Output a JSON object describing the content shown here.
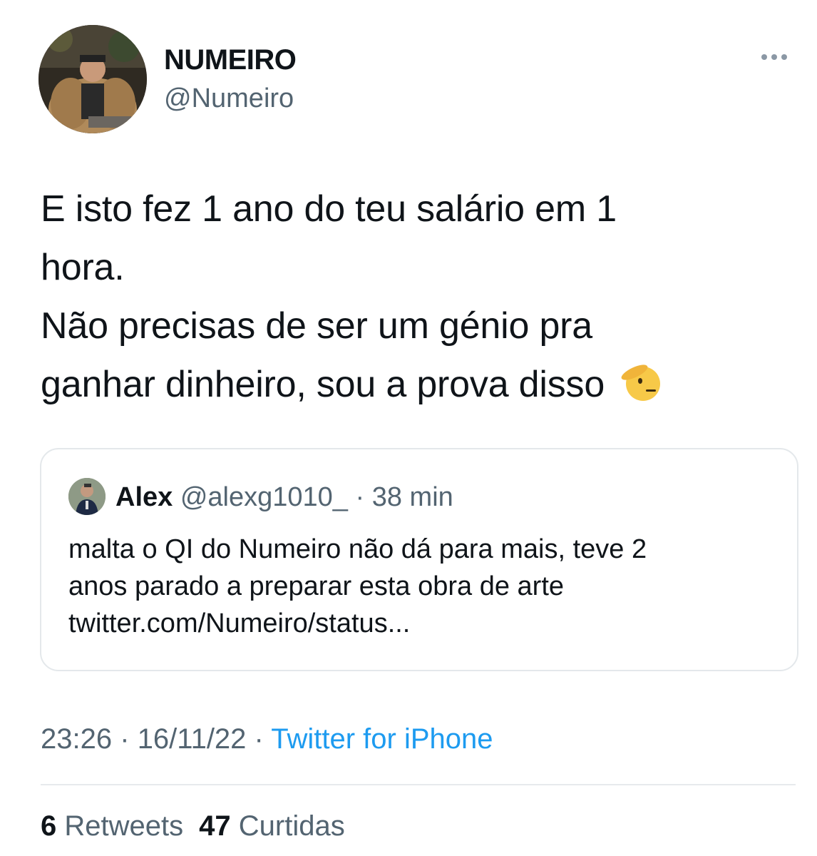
{
  "author": {
    "display_name": "NUMEIRO",
    "handle": "@Numeiro"
  },
  "tweet": {
    "lines": [
      "E isto fez 1 ano do teu salário em 1",
      "hora.",
      "Não precisas de ser um génio pra",
      "ganhar dinheiro, sou a prova disso"
    ],
    "emoji": "saluting-face-icon"
  },
  "quote": {
    "name": "Alex",
    "handle": "@alexg1010_",
    "separator": "·",
    "time": "38 min",
    "lines": [
      "malta o QI do Numeiro não dá para mais, teve 2",
      "anos parado a preparar esta obra de arte",
      "twitter.com/Numeiro/status..."
    ]
  },
  "meta": {
    "time": "23:26",
    "separator": "·",
    "date": "16/11/22",
    "source": "Twitter for iPhone"
  },
  "stats": {
    "retweets_count": "6",
    "retweets_label": "Retweets",
    "likes_count": "47",
    "likes_label": "Curtidas"
  },
  "colors": {
    "text": "#0f1419",
    "secondary": "#536471",
    "link": "#1d9bf0",
    "border": "#e4e8eb"
  }
}
